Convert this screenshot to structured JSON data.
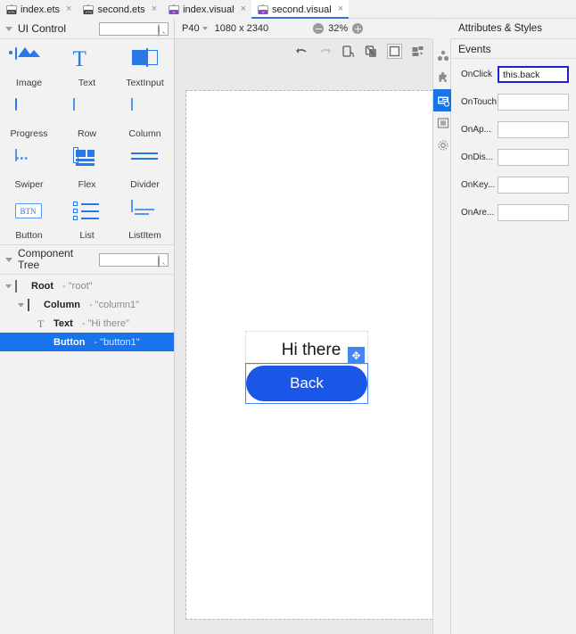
{
  "tabs": [
    {
      "label": "index.ets",
      "type": "ets",
      "active": false,
      "close": "×"
    },
    {
      "label": "second.ets",
      "type": "ets",
      "active": false,
      "close": "×"
    },
    {
      "label": "index.visual",
      "type": "visual",
      "active": false,
      "close": "×"
    },
    {
      "label": "second.visual",
      "type": "visual",
      "active": true,
      "close": "×"
    }
  ],
  "left_panel": {
    "ui_control": {
      "title": "UI Control",
      "search_placeholder": "",
      "search_value": "",
      "components": [
        {
          "label": "Image",
          "icon": "image-icon"
        },
        {
          "label": "Text",
          "icon": "text-icon"
        },
        {
          "label": "TextInput",
          "icon": "textinput-icon"
        },
        {
          "label": "Progress",
          "icon": "progress-icon"
        },
        {
          "label": "Row",
          "icon": "row-icon"
        },
        {
          "label": "Column",
          "icon": "column-icon"
        },
        {
          "label": "Swiper",
          "icon": "swiper-icon"
        },
        {
          "label": "Flex",
          "icon": "flex-icon"
        },
        {
          "label": "Divider",
          "icon": "divider-icon"
        },
        {
          "label": "Button",
          "icon": "button-icon",
          "glyph_text": "BTN"
        },
        {
          "label": "List",
          "icon": "list-icon"
        },
        {
          "label": "ListItem",
          "icon": "listitem-icon"
        }
      ]
    },
    "component_tree": {
      "title": "Component Tree",
      "search_placeholder": "",
      "search_value": "",
      "nodes": [
        {
          "name": "Root",
          "value": "- \"root\"",
          "icon": "root-icon",
          "depth": 0,
          "selected": false,
          "expandable": true
        },
        {
          "name": "Column",
          "value": "- \"column1\"",
          "icon": "column-icon",
          "depth": 1,
          "selected": false,
          "expandable": true
        },
        {
          "name": "Text",
          "value": "- \"Hi there\"",
          "icon": "text-icon",
          "depth": 2,
          "selected": false,
          "expandable": false
        },
        {
          "name": "Button",
          "value": "- \"button1\"",
          "icon": "button-icon",
          "depth": 2,
          "selected": true,
          "expandable": false
        }
      ]
    }
  },
  "canvas_toolbar": {
    "device": "P40",
    "resolution": "1080 x 2340",
    "zoom": "32%",
    "zoom_out_icon": "minus-circle-icon",
    "zoom_in_icon": "plus-circle-icon",
    "actions": [
      {
        "name": "undo-icon"
      },
      {
        "name": "redo-icon"
      },
      {
        "name": "device-rotate-icon"
      },
      {
        "name": "layout-overlay-icon"
      },
      {
        "name": "bounds-icon"
      },
      {
        "name": "export-icon"
      }
    ]
  },
  "preview": {
    "text_label": "Hi there",
    "button_label": "Back",
    "button_color": "#1a56e8",
    "selection_color": "#4285f4",
    "drag_handle_icon": "move-icon",
    "drag_handle_glyph": "✥"
  },
  "rail": [
    {
      "name": "components-icon",
      "active": false
    },
    {
      "name": "plugin-icon",
      "active": false
    },
    {
      "name": "attributes-icon",
      "active": true
    },
    {
      "name": "preview-icon",
      "active": false
    },
    {
      "name": "settings-icon",
      "active": false
    }
  ],
  "right_panel": {
    "title": "Attributes & Styles",
    "section_title": "Events",
    "events": [
      {
        "label": "OnClick",
        "value": "this.back",
        "focused": true
      },
      {
        "label": "OnTouch",
        "value": "",
        "focused": false
      },
      {
        "label": "OnAp...",
        "value": "",
        "focused": false
      },
      {
        "label": "OnDis...",
        "value": "",
        "focused": false
      },
      {
        "label": "OnKey...",
        "value": "",
        "focused": false
      },
      {
        "label": "OnAre...",
        "value": "",
        "focused": false
      }
    ]
  }
}
